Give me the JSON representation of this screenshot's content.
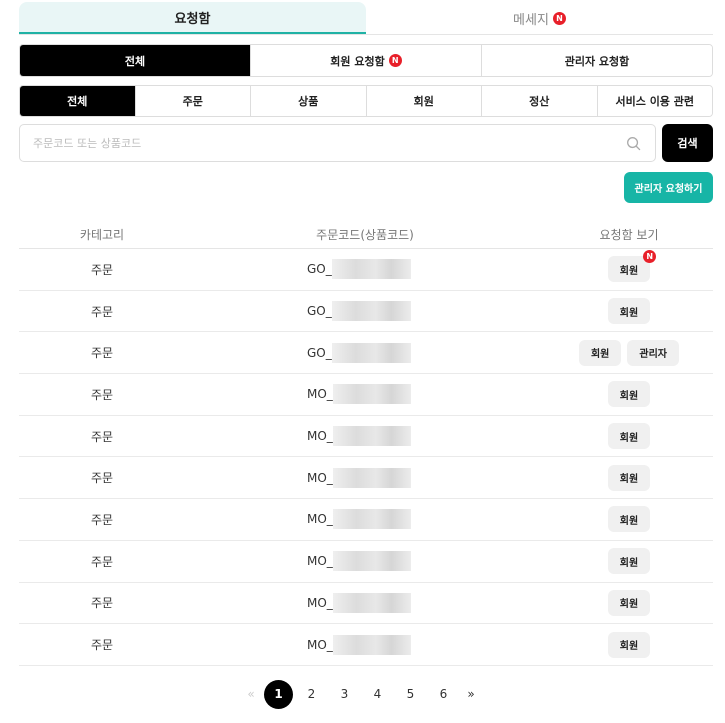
{
  "top_tabs": {
    "inbox": "요청함",
    "messages": "메세지",
    "new_badge": "N"
  },
  "filter_type": {
    "all": "전체",
    "member_requests": "회원 요청함",
    "admin_requests": "관리자 요청함"
  },
  "filter_category": [
    "전체",
    "주문",
    "상품",
    "회원",
    "정산",
    "서비스 이용 관련"
  ],
  "search": {
    "placeholder": "주문코드 또는 상품코드",
    "value": "",
    "button": "검색"
  },
  "admin_request_button": "관리자 요청하기",
  "table": {
    "headers": [
      "카테고리",
      "주문코드(상품코드)",
      "요청함 보기"
    ],
    "rows": [
      {
        "category": "주문",
        "code_prefix": "GO_",
        "buttons": [
          "회원"
        ],
        "badge": true
      },
      {
        "category": "주문",
        "code_prefix": "GO_",
        "buttons": [
          "회원"
        ],
        "badge": false
      },
      {
        "category": "주문",
        "code_prefix": "GO_",
        "buttons": [
          "회원",
          "관리자"
        ],
        "badge": false
      },
      {
        "category": "주문",
        "code_prefix": "MO_",
        "buttons": [
          "회원"
        ],
        "badge": false
      },
      {
        "category": "주문",
        "code_prefix": "MO_",
        "buttons": [
          "회원"
        ],
        "badge": false
      },
      {
        "category": "주문",
        "code_prefix": "MO_",
        "buttons": [
          "회원"
        ],
        "badge": false
      },
      {
        "category": "주문",
        "code_prefix": "MO_",
        "buttons": [
          "회원"
        ],
        "badge": false
      },
      {
        "category": "주문",
        "code_prefix": "MO_",
        "buttons": [
          "회원"
        ],
        "badge": false
      },
      {
        "category": "주문",
        "code_prefix": "MO_",
        "buttons": [
          "회원"
        ],
        "badge": false
      },
      {
        "category": "주문",
        "code_prefix": "MO_",
        "buttons": [
          "회원"
        ],
        "badge": false
      }
    ]
  },
  "pagination": {
    "prev": "«",
    "pages": [
      "1",
      "2",
      "3",
      "4",
      "5",
      "6"
    ],
    "current": "1",
    "next": "»"
  },
  "colors": {
    "accent": "#17b5a6",
    "badge": "#e8202a",
    "active_segment": "#000000"
  }
}
